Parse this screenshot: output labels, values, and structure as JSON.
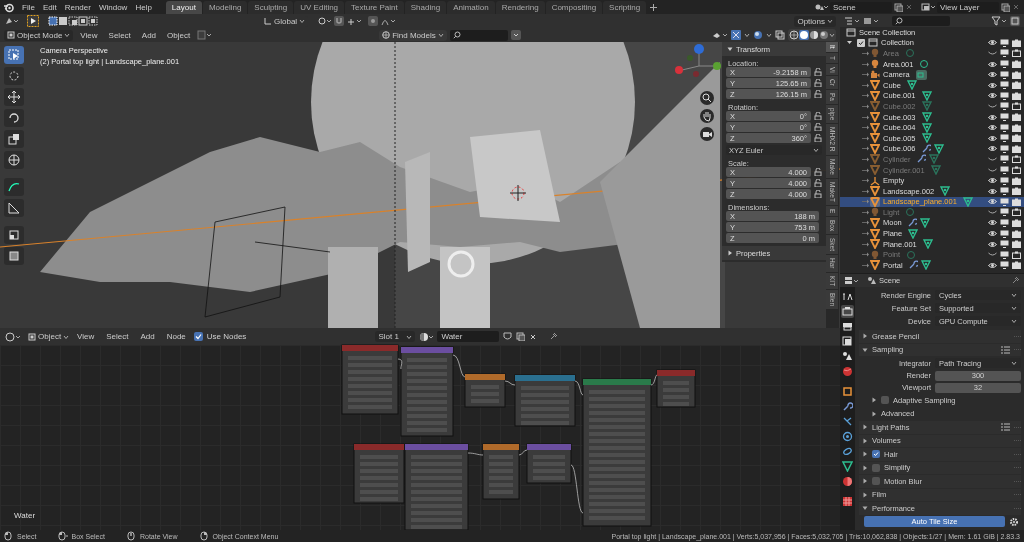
{
  "top_bar": {
    "menus": [
      "File",
      "Edit",
      "Render",
      "Window",
      "Help"
    ],
    "workspaces": [
      {
        "label": "Layout",
        "selected": true
      },
      {
        "label": "Modeling",
        "selected": false
      },
      {
        "label": "Sculpting",
        "selected": false
      },
      {
        "label": "UV Editing",
        "selected": false
      },
      {
        "label": "Texture Paint",
        "selected": false
      },
      {
        "label": "Shading",
        "selected": false
      },
      {
        "label": "Animation",
        "selected": false
      },
      {
        "label": "Rendering",
        "selected": false
      },
      {
        "label": "Compositing",
        "selected": false
      },
      {
        "label": "Scripting",
        "selected": false
      }
    ],
    "scene": "Scene",
    "view_layer": "View Layer"
  },
  "viewport": {
    "orientation": "Global",
    "options": "Options",
    "mode": "Object Mode",
    "menus": [
      "View",
      "Select",
      "Add",
      "Object"
    ],
    "find": "Find Models",
    "camera": "Camera Perspective",
    "active": "(2) Portal top light | Landscape_plane.001",
    "transform": {
      "title": "Transform",
      "groups": [
        {
          "label": "Location:",
          "rows": [
            {
              "axis": "X",
              "value": "-9.2158 m"
            },
            {
              "axis": "Y",
              "value": "125.65 m"
            },
            {
              "axis": "Z",
              "value": "126.15 m"
            }
          ],
          "locks": true
        },
        {
          "label": "Rotation:",
          "rows": [
            {
              "axis": "X",
              "value": "0°"
            },
            {
              "axis": "Y",
              "value": "0°"
            },
            {
              "axis": "Z",
              "value": "360°"
            }
          ],
          "locks": true,
          "mode": "XYZ Euler"
        },
        {
          "label": "Scale:",
          "rows": [
            {
              "axis": "X",
              "value": "4.000"
            },
            {
              "axis": "Y",
              "value": "4.000"
            },
            {
              "axis": "Z",
              "value": "4.000"
            }
          ],
          "locks": true
        },
        {
          "label": "Dimensions:",
          "rows": [
            {
              "axis": "X",
              "value": "188 m"
            },
            {
              "axis": "Y",
              "value": "753 m"
            },
            {
              "axis": "Z",
              "value": "0 m"
            }
          ],
          "locks": false
        }
      ]
    },
    "properties_panel": "Properties",
    "tabs": [
      {
        "label": "It",
        "selected": true
      },
      {
        "label": "T",
        "selected": false
      },
      {
        "label": "Vi",
        "selected": false
      },
      {
        "label": "Cr",
        "selected": false
      },
      {
        "label": "Pa",
        "selected": false
      },
      {
        "label": "pipe",
        "selected": false
      },
      {
        "label": "MHX2 R",
        "selected": false
      },
      {
        "label": "Make",
        "selected": false
      },
      {
        "label": "MakeT",
        "selected": false
      },
      {
        "label": "E",
        "selected": false
      },
      {
        "label": "Box",
        "selected": false
      },
      {
        "label": "Sket",
        "selected": false
      },
      {
        "label": "Har",
        "selected": false
      },
      {
        "label": "KIT",
        "selected": false
      },
      {
        "label": "Blen",
        "selected": false
      }
    ]
  },
  "node_editor": {
    "object": "Object",
    "menus": [
      "View",
      "Select",
      "Add",
      "Node"
    ],
    "use_nodes": {
      "label": "Use Nodes",
      "checked": true
    },
    "slot": "Slot 1",
    "material": "Water",
    "material_label": "Water"
  },
  "outliner": {
    "root": "Scene Collection",
    "collection": {
      "name": "Collection",
      "checked": true,
      "expanded": true,
      "children": [
        {
          "name": "Area",
          "kind": "light",
          "visible": false,
          "selected": false,
          "modifier": false
        },
        {
          "name": "Area.001",
          "kind": "light",
          "visible": true,
          "selected": false,
          "modifier": false
        },
        {
          "name": "Camera",
          "kind": "camera",
          "visible": true,
          "selected": false,
          "modifier": false
        },
        {
          "name": "Cube",
          "kind": "mesh",
          "visible": true,
          "selected": false,
          "modifier": false
        },
        {
          "name": "Cube.001",
          "kind": "mesh",
          "visible": true,
          "selected": false,
          "modifier": false
        },
        {
          "name": "Cube.002",
          "kind": "mesh",
          "visible": false,
          "selected": false,
          "modifier": false
        },
        {
          "name": "Cube.003",
          "kind": "mesh",
          "visible": true,
          "selected": false,
          "modifier": false
        },
        {
          "name": "Cube.004",
          "kind": "mesh",
          "visible": true,
          "selected": false,
          "modifier": false
        },
        {
          "name": "Cube.005",
          "kind": "mesh",
          "visible": true,
          "selected": false,
          "modifier": false
        },
        {
          "name": "Cube.006",
          "kind": "mesh",
          "visible": true,
          "selected": false,
          "modifier": true
        },
        {
          "name": "Cylinder",
          "kind": "mesh",
          "visible": false,
          "selected": false,
          "modifier": true
        },
        {
          "name": "Cylinder.001",
          "kind": "mesh",
          "visible": false,
          "selected": false,
          "modifier": false
        },
        {
          "name": "Empty",
          "kind": "empty",
          "visible": true,
          "selected": false,
          "modifier": false
        },
        {
          "name": "Landscape.002",
          "kind": "mesh",
          "visible": true,
          "selected": false,
          "modifier": false
        },
        {
          "name": "Landscape_plane.001",
          "kind": "mesh",
          "visible": true,
          "selected": true,
          "modifier": false
        },
        {
          "name": "Light",
          "kind": "light",
          "visible": false,
          "selected": false,
          "modifier": false
        },
        {
          "name": "Moon",
          "kind": "mesh",
          "visible": true,
          "selected": false,
          "modifier": true
        },
        {
          "name": "Plane",
          "kind": "mesh",
          "visible": true,
          "selected": false,
          "modifier": false
        },
        {
          "name": "Plane.001",
          "kind": "mesh",
          "visible": true,
          "selected": false,
          "modifier": false
        },
        {
          "name": "Point",
          "kind": "light",
          "visible": false,
          "selected": false,
          "modifier": false
        },
        {
          "name": "Portal",
          "kind": "mesh",
          "visible": true,
          "selected": false,
          "modifier": true
        }
      ]
    }
  },
  "properties": {
    "context": "Scene",
    "tabs": [
      {
        "kind": "tool",
        "selected": false
      },
      {
        "kind": "render",
        "selected": true
      },
      {
        "kind": "output",
        "selected": false
      },
      {
        "kind": "view-layer",
        "selected": false
      },
      {
        "kind": "scene",
        "selected": false
      },
      {
        "kind": "world",
        "selected": false
      },
      {
        "kind": "object",
        "selected": false
      },
      {
        "kind": "modifier",
        "selected": false
      },
      {
        "kind": "particles",
        "selected": false
      },
      {
        "kind": "physics",
        "selected": false
      },
      {
        "kind": "constraint",
        "selected": false
      },
      {
        "kind": "data",
        "selected": false
      },
      {
        "kind": "material",
        "selected": false
      },
      {
        "kind": "texture",
        "selected": false
      }
    ],
    "fields": [
      {
        "label": "Render Engine",
        "value": "Cycles"
      },
      {
        "label": "Feature Set",
        "value": "Supported"
      },
      {
        "label": "Device",
        "value": "GPU Compute"
      }
    ],
    "panels": [
      {
        "title": "Grease Pencil",
        "kind": "plain",
        "expanded": false,
        "presets": false
      },
      {
        "title": "Sampling",
        "kind": "plain",
        "expanded": true,
        "presets": true,
        "integrator": {
          "label": "Integrator",
          "value": "Path Tracing"
        },
        "samples": [
          {
            "label": "Render",
            "value": "300"
          },
          {
            "label": "Viewport",
            "value": "32"
          }
        ],
        "subpanels": [
          {
            "title": "Adaptive Sampling",
            "kind": "checkbox",
            "checked": false
          },
          {
            "title": "Advanced",
            "kind": "plain"
          }
        ]
      },
      {
        "title": "Light Paths",
        "kind": "plain",
        "expanded": false,
        "presets": true
      },
      {
        "title": "Volumes",
        "kind": "plain",
        "expanded": false,
        "presets": false
      },
      {
        "title": "Hair",
        "kind": "checkbox",
        "checked": true,
        "expanded": false,
        "presets": false
      },
      {
        "title": "Simplify",
        "kind": "checkbox",
        "checked": false,
        "expanded": false,
        "presets": false
      },
      {
        "title": "Motion Blur",
        "kind": "checkbox",
        "checked": false,
        "expanded": false,
        "presets": false
      },
      {
        "title": "Film",
        "kind": "plain",
        "expanded": false,
        "presets": false
      },
      {
        "title": "Performance",
        "kind": "plain",
        "expanded": true,
        "presets": false,
        "button": "Auto Tile Size"
      }
    ]
  },
  "status_bar": {
    "hints": [
      {
        "kind": "mouse-left",
        "label": "Select"
      },
      {
        "kind": "mouse-drag",
        "label": "Box Select"
      },
      {
        "kind": "mouse-middle",
        "label": "Rotate View"
      },
      {
        "kind": "mouse-right",
        "label": "Object Context Menu"
      }
    ],
    "stats": "Portal top light | Landscape_plane.001 | Verts:5,037,956 | Faces:5,032,705 | Tris:10,062,838 | Objects:1/27 | Mem: 1.61 GiB | 2.83.3"
  }
}
